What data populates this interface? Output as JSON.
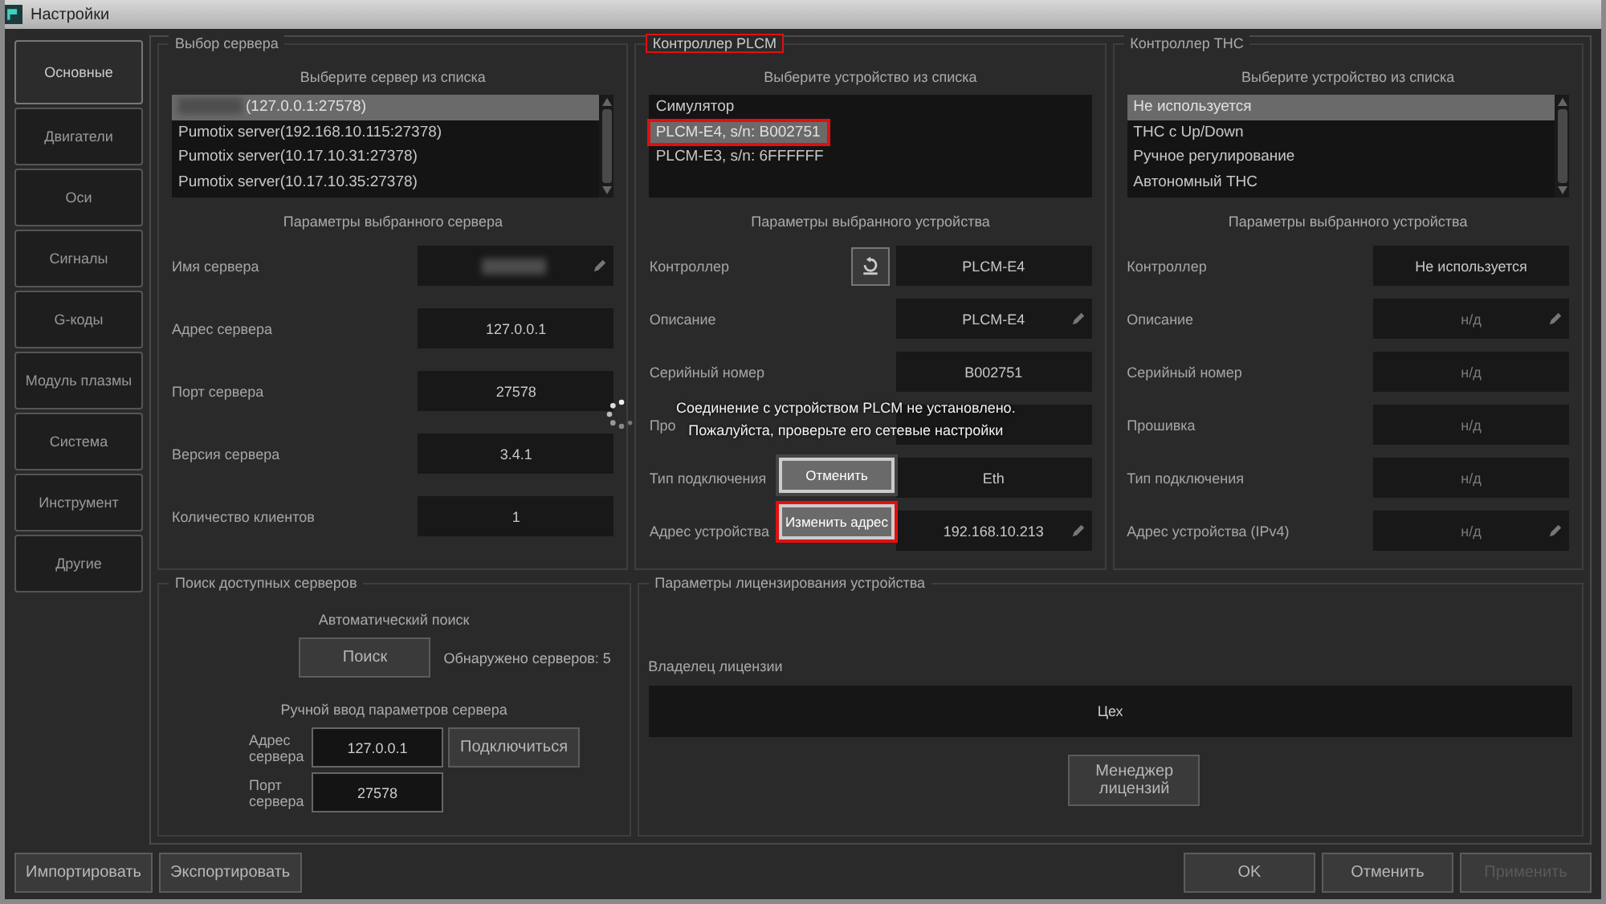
{
  "window": {
    "title": "Настройки"
  },
  "tabs": [
    {
      "label": "Основные",
      "selected": true
    },
    {
      "label": "Двигатели",
      "selected": false
    },
    {
      "label": "Оси",
      "selected": false
    },
    {
      "label": "Сигналы",
      "selected": false
    },
    {
      "label": "G-коды",
      "selected": false
    },
    {
      "label": "Модуль плазмы",
      "selected": false
    },
    {
      "label": "Система",
      "selected": false
    },
    {
      "label": "Инструмент",
      "selected": false
    },
    {
      "label": "Другие",
      "selected": false
    }
  ],
  "server_group": {
    "title": "Выбор сервера",
    "highlighted": false,
    "list_caption": "Выберите сервер из списка",
    "items": [
      {
        "address": "(127.0.0.1:27578)",
        "name_hidden": true,
        "selected": true
      },
      {
        "name": "Pumotix server",
        "address": "(192.168.10.115:27378)",
        "name_hidden": false,
        "selected": false
      },
      {
        "name": "Pumotix server",
        "address": "(10.17.10.31:27378)",
        "name_hidden": false,
        "selected": false
      },
      {
        "name": "Pumotix server",
        "address": "(10.17.10.35:27378)",
        "name_hidden": false,
        "selected": false
      }
    ],
    "params_caption": "Параметры выбранного сервера",
    "fields": [
      {
        "label": "Имя сервера",
        "value_hidden": true,
        "editable": true
      },
      {
        "label": "Адрес сервера",
        "value": "127.0.0.1",
        "editable": false
      },
      {
        "label": "Порт сервера",
        "value": "27578",
        "editable": false
      },
      {
        "label": "Версия сервера",
        "value": "3.4.1",
        "editable": false
      },
      {
        "label": "Количество клиентов",
        "value": "1",
        "editable": false
      }
    ]
  },
  "plcm_group": {
    "title": "Контроллер PLCM",
    "highlighted": true,
    "list_caption": "Выберите устройство из списка",
    "items": [
      {
        "name": "Симулятор",
        "selected": false,
        "highlighted": false
      },
      {
        "name": "PLCM-E4, s/n: B002751",
        "selected": true,
        "highlighted": true
      },
      {
        "name": "PLCM-E3, s/n: 6FFFFFF",
        "selected": false,
        "highlighted": false
      }
    ],
    "params_caption": "Параметры выбранного устройства",
    "fields": [
      {
        "label": "Контроллер",
        "value": "PLCM-E4",
        "kind": "refresh",
        "editable": false
      },
      {
        "label": "Описание",
        "value": "PLCM-E4",
        "editable": true
      },
      {
        "label": "Серийный номер",
        "value": "B002751",
        "editable": false
      },
      {
        "label": "Про",
        "editable": false
      },
      {
        "label": "Тип подключения",
        "value": "Eth",
        "editable": false
      },
      {
        "label": "Адрес устройства",
        "value": "192.168.10.213",
        "editable": true
      }
    ]
  },
  "thc_group": {
    "title": "Контроллер THC",
    "highlighted": false,
    "list_caption": "Выберите устройство из списка",
    "items": [
      {
        "name": "Не используется",
        "selected": true,
        "highlighted": false
      },
      {
        "name": "THC с Up/Down",
        "selected": false,
        "highlighted": false
      },
      {
        "name": "Ручное регулирование",
        "selected": false,
        "highlighted": false
      },
      {
        "name": "Автономный THC",
        "selected": false,
        "highlighted": false
      }
    ],
    "params_caption": "Параметры выбранного устройства",
    "fields": [
      {
        "label": "Контроллер",
        "value": "Не используется",
        "editable": false,
        "disabled": false
      },
      {
        "label": "Описание",
        "value": "н/д",
        "editable": true,
        "disabled": true
      },
      {
        "label": "Серийный номер",
        "value": "н/д",
        "editable": false,
        "disabled": true
      },
      {
        "label": "Прошивка",
        "value": "н/д",
        "editable": false,
        "disabled": true
      },
      {
        "label": "Тип подключения",
        "value": "н/д",
        "editable": false,
        "disabled": true
      },
      {
        "label": "Адрес устройства (IPv4)",
        "value": "н/д",
        "editable": true,
        "disabled": true
      }
    ]
  },
  "search_group": {
    "title": "Поиск доступных серверов",
    "auto_caption": "Автоматический поиск",
    "search_button": "Поиск",
    "found": "Обнаружено серверов: 5",
    "manual_caption": "Ручной ввод параметров сервера",
    "address_label": "Адрес сервера",
    "address": "127.0.0.1",
    "connect_button": "Подключиться",
    "port_label": "Порт сервера",
    "port": "27578"
  },
  "license_group": {
    "title": "Параметры лицензирования устройства",
    "owner_label": "Владелец лицензии",
    "owner": "Цех",
    "manager_button": "Менеджер лицензий"
  },
  "dialog": {
    "message": [
      "Соединение с устройством PLCM не установлено.",
      "Пожалуйста, проверьте его сетевые настройки"
    ],
    "buttons": [
      {
        "label": "Отменить",
        "highlighted": false
      },
      {
        "label": "Изменить адрес",
        "highlighted": true
      }
    ]
  },
  "footer": {
    "left": [
      {
        "label": "Импортировать",
        "disabled": false
      },
      {
        "label": "Экспортировать",
        "disabled": false
      }
    ],
    "right": [
      {
        "label": "OK",
        "disabled": false
      },
      {
        "label": "Отменить",
        "disabled": false
      },
      {
        "label": "Применить",
        "disabled": true
      }
    ]
  }
}
